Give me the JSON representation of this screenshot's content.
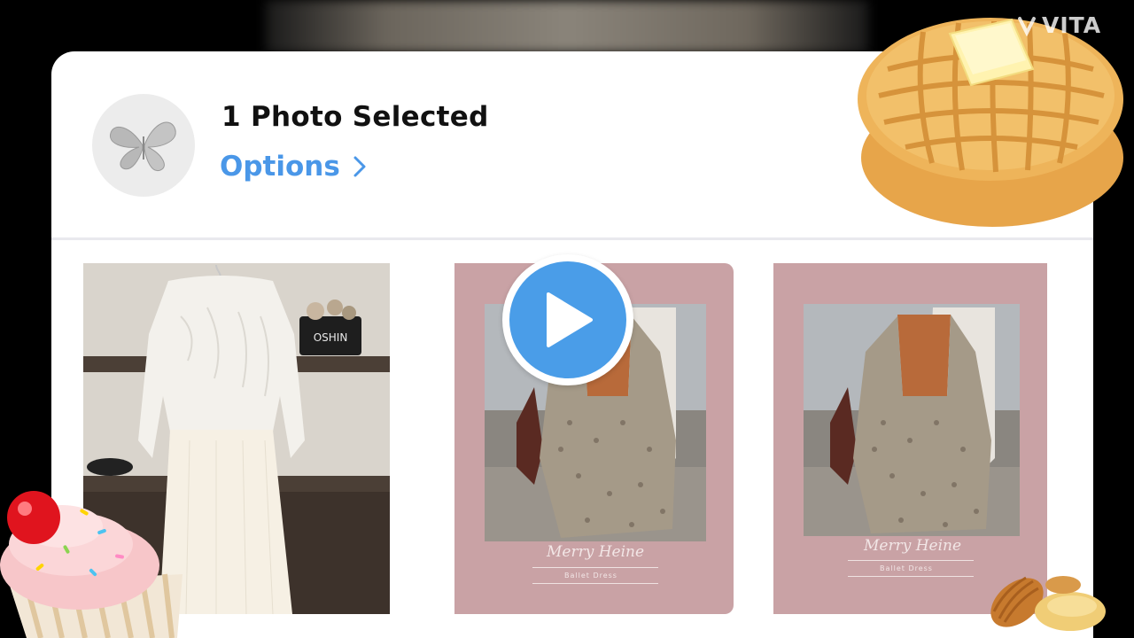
{
  "header": {
    "title": "1 Photo Selected",
    "options_label": "Options"
  },
  "photos": [
    {
      "description_icon": "white-sweater-skirt-photo",
      "bag_text": "OSHIN"
    },
    {
      "description_icon": "floral-dress-photo",
      "caption_script": "Merry Heine",
      "caption_sub": "Ballet Dress"
    },
    {
      "description_icon": "floral-dress-photo",
      "caption_script": "Merry Heine",
      "caption_sub": "Ballet Dress"
    }
  ],
  "watermark": {
    "text": "VITA"
  },
  "colors": {
    "accent": "#4a97e8",
    "play_button": "#4a9de8",
    "card_background": "#ffffff",
    "photo_backdrop": "#c9a2a5"
  },
  "icons": [
    "butterfly-avatar-icon",
    "chevron-right-icon",
    "play-icon",
    "waffle-sticker",
    "cupcake-sticker",
    "madeleine-sticker"
  ]
}
